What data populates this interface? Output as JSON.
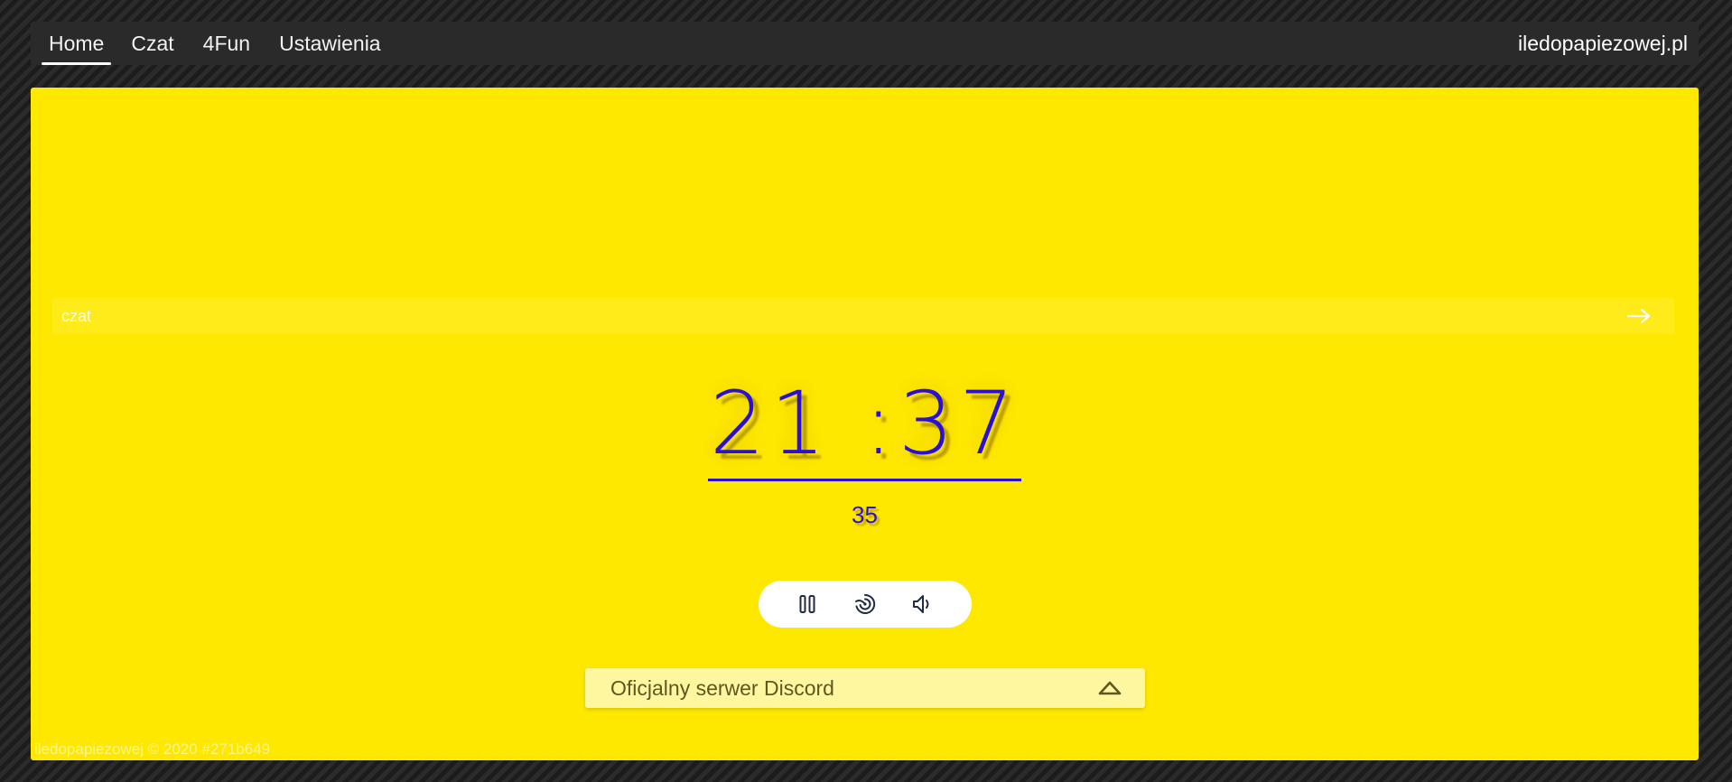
{
  "nav": {
    "items": [
      {
        "label": "Home",
        "active": true
      },
      {
        "label": "Czat",
        "active": false
      },
      {
        "label": "4Fun",
        "active": false
      },
      {
        "label": "Ustawienia",
        "active": false
      }
    ],
    "brand": "iledopapiezowej.pl"
  },
  "chat": {
    "placeholder": "czat",
    "send_icon": "arrow-right-icon"
  },
  "clock": {
    "hours": "21",
    "separator": ":",
    "minutes": "37",
    "seconds": "35"
  },
  "controls": [
    {
      "name": "pause-button",
      "icon": "pause-icon"
    },
    {
      "name": "vibrate-button",
      "icon": "vibration-icon"
    },
    {
      "name": "sound-button",
      "icon": "speaker-icon"
    }
  ],
  "discord": {
    "label": "Oficjalny serwer Discord",
    "icon": "chevron-up-icon"
  },
  "footer": {
    "text": "iledopapiezowej © 2020 #271b649"
  },
  "colors": {
    "panel": "#ffe800",
    "accent": "#2a0fd8",
    "navbar": "#2a2a2a",
    "discord_bg": "#fff6a0"
  }
}
